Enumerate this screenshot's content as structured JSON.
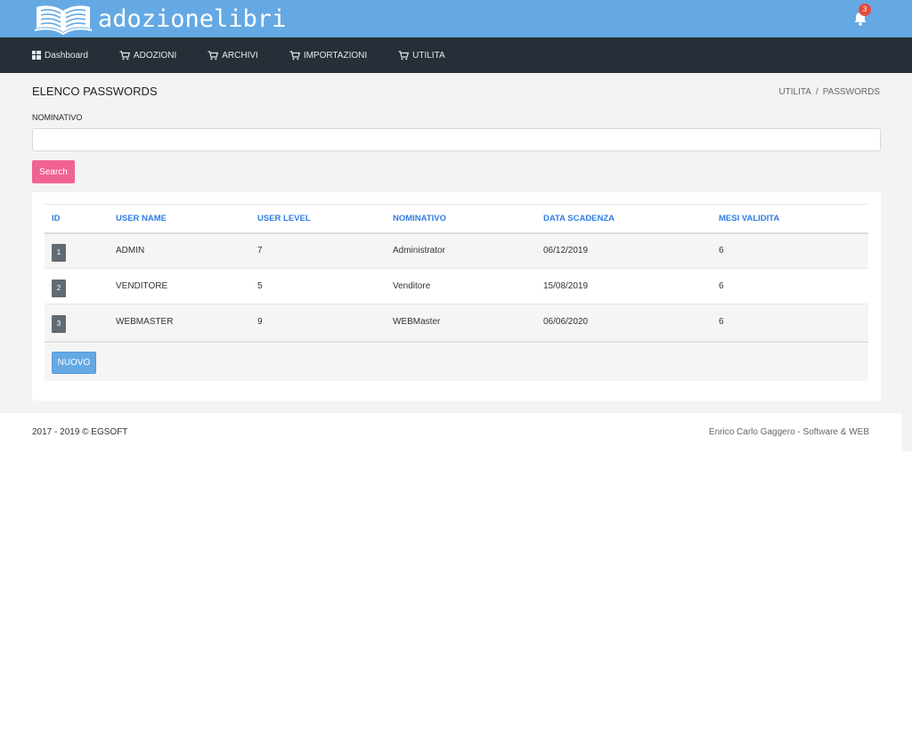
{
  "app": {
    "logo_text": "adozionelibri",
    "notifications_count": "3",
    "icons": {
      "logo": "open-book-icon",
      "notifications": "bell-icon"
    }
  },
  "nav": {
    "items": [
      {
        "label": "Dashboard",
        "icon": "grid-icon"
      },
      {
        "label": "ADOZIONI",
        "icon": "cart-icon"
      },
      {
        "label": "ARCHIVI",
        "icon": "cart-icon"
      },
      {
        "label": "IMPORTAZIONI",
        "icon": "cart-icon"
      },
      {
        "label": "UTILITA",
        "icon": "cart-icon"
      }
    ]
  },
  "page": {
    "title": "ELENCO PASSWORDS",
    "breadcrumb": [
      "UTILITA",
      "/",
      "PASSWORDS"
    ]
  },
  "filter": {
    "label": "NOMINATIVO",
    "value": "",
    "search_label": "Search"
  },
  "table": {
    "headers": [
      "ID",
      "USER NAME",
      "USER LEVEL",
      "NOMINATIVO",
      "DATA SCADENZA",
      "MESI VALIDITA"
    ],
    "rows": [
      {
        "id": "1",
        "username": "ADMIN",
        "level": "7",
        "nominativo": "Administrator",
        "scadenza": "06/12/2019",
        "mesi": "6"
      },
      {
        "id": "2",
        "username": "VENDITORE",
        "level": "5",
        "nominativo": "Venditore",
        "scadenza": "15/08/2019",
        "mesi": "6"
      },
      {
        "id": "3",
        "username": "WEBMASTER",
        "level": "9",
        "nominativo": "WEBMaster",
        "scadenza": "06/06/2020",
        "mesi": "6"
      }
    ],
    "new_label": "NUOVO"
  },
  "footer": {
    "left": "2017 - 2019 © EGSOFT",
    "right": "Enrico Carlo Gaggero - Software & WEB"
  },
  "colors": {
    "topbar": "#65a9e4",
    "navbar": "#262f37",
    "accent_link": "#2e7de0",
    "search_button": "#f06391",
    "badge": "#e74c3c"
  }
}
